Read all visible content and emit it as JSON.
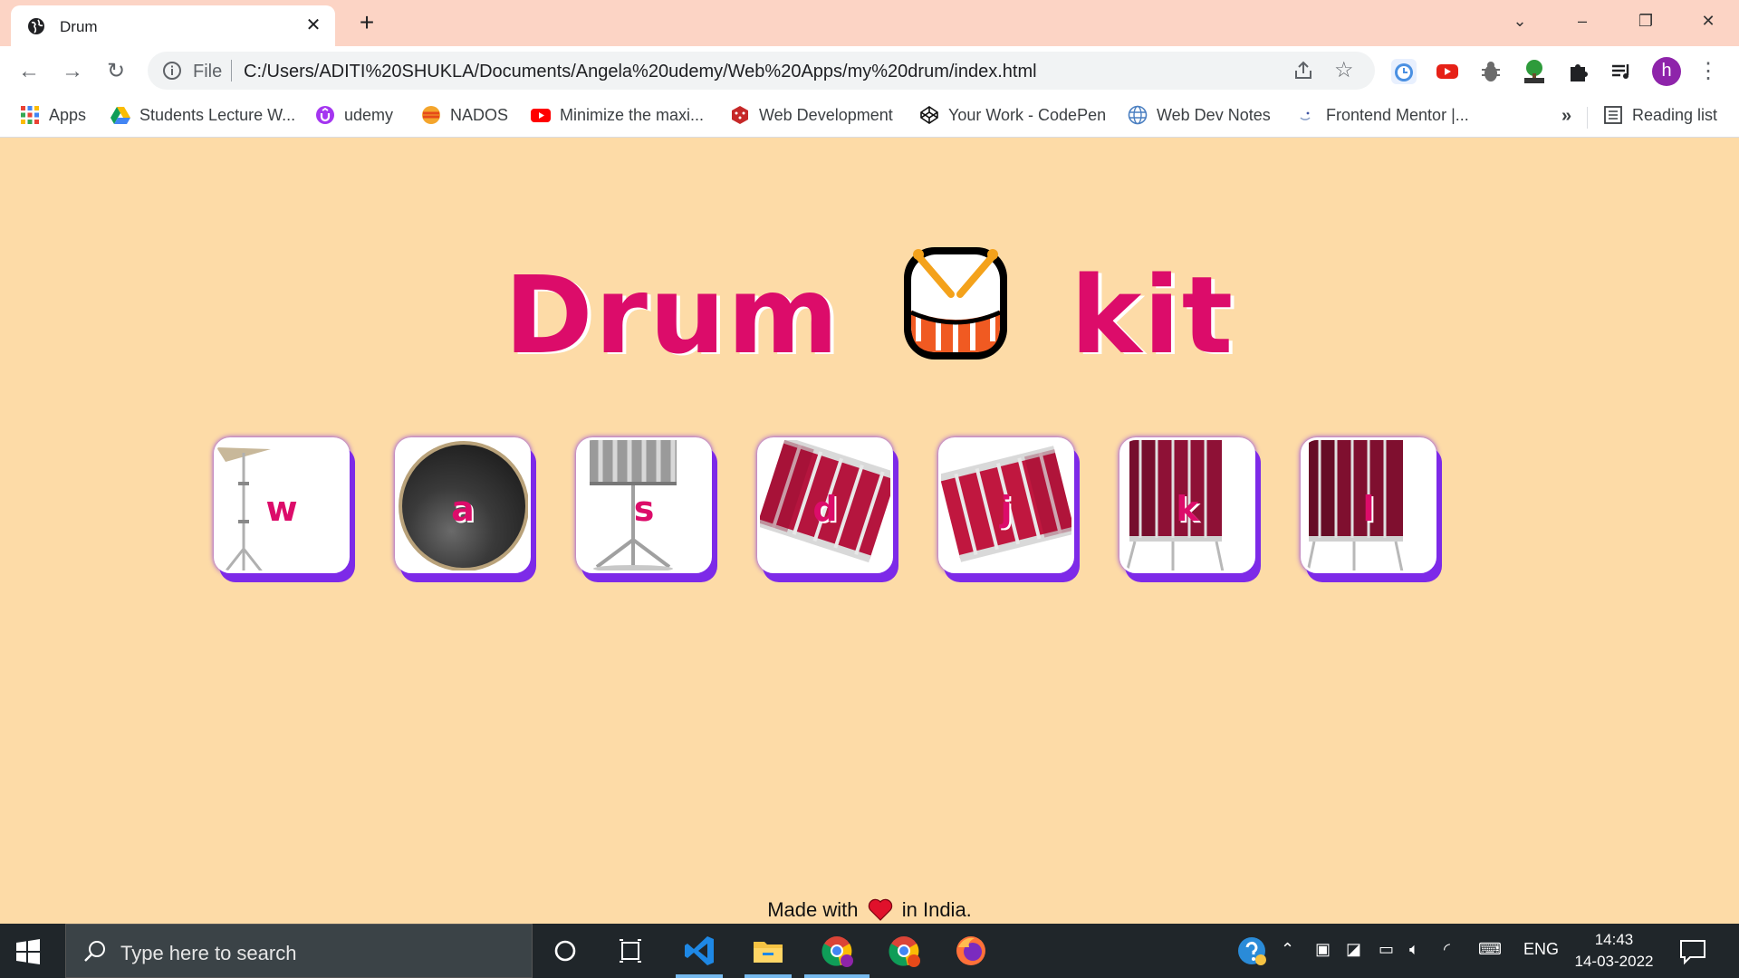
{
  "browser": {
    "tab_title": "Drum",
    "new_tab": "+",
    "url_scheme_label": "File",
    "url": "C:/Users/ADITI%20SHUKLA/Documents/Angela%20udemy/Web%20Apps/my%20drum/index.html",
    "profile_initial": "h",
    "bookmarks": [
      {
        "label": "Apps",
        "icon": "apps-grid-icon"
      },
      {
        "label": "Students Lecture W...",
        "icon": "google-drive-icon"
      },
      {
        "label": "udemy",
        "icon": "udemy-icon"
      },
      {
        "label": "NADOS",
        "icon": "nados-icon"
      },
      {
        "label": "Minimize the maxi...",
        "icon": "youtube-icon"
      },
      {
        "label": "Web Development",
        "icon": "dice-icon"
      },
      {
        "label": "Your Work - CodePen",
        "icon": "codepen-icon"
      },
      {
        "label": "Web Dev Notes",
        "icon": "globe-icon"
      },
      {
        "label": "Frontend Mentor |...",
        "icon": "frontend-mentor-icon"
      }
    ],
    "bookmarks_more": "»",
    "reading_list": "Reading list"
  },
  "page": {
    "title_left": "Drum",
    "title_right": "kit",
    "drums": [
      {
        "key": "w",
        "instrument": "cymbal"
      },
      {
        "key": "a",
        "instrument": "bass-drum"
      },
      {
        "key": "s",
        "instrument": "snare"
      },
      {
        "key": "d",
        "instrument": "tom"
      },
      {
        "key": "j",
        "instrument": "tom"
      },
      {
        "key": "k",
        "instrument": "floor-tom"
      },
      {
        "key": "l",
        "instrument": "floor-tom"
      }
    ],
    "footer_before": "Made with",
    "footer_after": "in India."
  },
  "taskbar": {
    "search_placeholder": "Type here to search",
    "language": "ENG",
    "time": "14:43",
    "date": "14-03-2022"
  },
  "colors": {
    "page_bg": "#fddba7",
    "title": "#dc0c6a",
    "drum_shadow": "#7d2ae8",
    "tab_strip": "#fcd4c5"
  }
}
